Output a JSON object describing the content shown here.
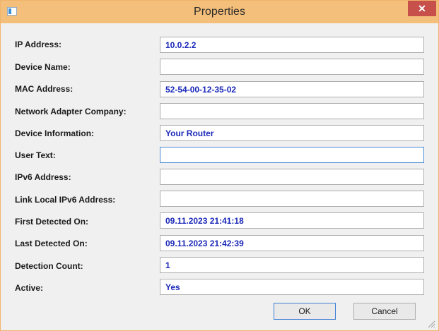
{
  "window": {
    "title": "Properties",
    "close_glyph": "✕"
  },
  "fields": [
    {
      "label": "IP Address:",
      "value": "10.0.2.2"
    },
    {
      "label": "Device Name:",
      "value": ""
    },
    {
      "label": "MAC Address:",
      "value": "52-54-00-12-35-02"
    },
    {
      "label": "Network Adapter Company:",
      "value": ""
    },
    {
      "label": "Device Information:",
      "value": "Your Router"
    },
    {
      "label": "User Text:",
      "value": ""
    },
    {
      "label": "IPv6 Address:",
      "value": ""
    },
    {
      "label": "Link Local IPv6 Address:",
      "value": ""
    },
    {
      "label": "First Detected On:",
      "value": "09.11.2023 21:41:18"
    },
    {
      "label": "Last Detected On:",
      "value": "09.11.2023 21:42:39"
    },
    {
      "label": "Detection Count:",
      "value": "1"
    },
    {
      "label": "Active:",
      "value": "Yes"
    }
  ],
  "buttons": {
    "ok": "OK",
    "cancel": "Cancel"
  },
  "colors": {
    "title_bar": "#f4bf7a",
    "close": "#c7504a",
    "value_text": "#1a28b8"
  }
}
